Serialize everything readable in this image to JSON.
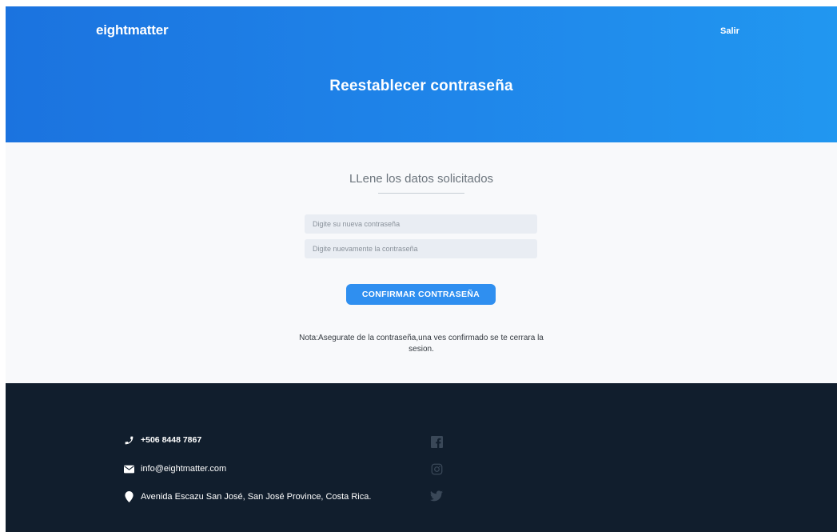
{
  "header": {
    "brand": "eightmatter",
    "logout_label": "Salir",
    "title": "Reestablecer contraseña",
    "gradient_start": "#1b73df",
    "gradient_end": "#2197f0"
  },
  "form": {
    "subtitle": "LLene los datos solicitados",
    "new_password_placeholder": "Digite su nueva contraseña",
    "confirm_password_placeholder": "Digite nuevamente la contraseña",
    "confirm_button_label": "CONFIRMAR CONTRASEÑA",
    "note": "Nota:Asegurate de la contraseña,una ves confirmado se te cerrara la sesion.",
    "button_color": "#2f8ff0"
  },
  "footer": {
    "background": "#111e2d",
    "contacts": [
      {
        "icon": "phone-icon",
        "text": "+506 8448 7867"
      },
      {
        "icon": "envelope-icon",
        "text": "info@eightmatter.com"
      },
      {
        "icon": "map-marker-icon",
        "text": "Avenida Escazu San José, San José Province, Costa Rica."
      }
    ],
    "social": [
      {
        "icon": "facebook-icon"
      },
      {
        "icon": "instagram-icon"
      },
      {
        "icon": "twitter-icon"
      }
    ]
  }
}
